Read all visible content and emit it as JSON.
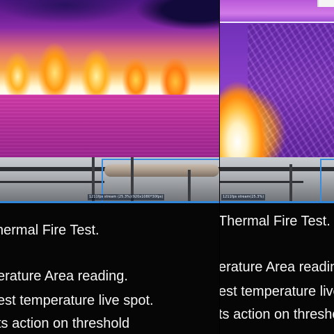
{
  "left_panel": {
    "stream_label": "1211fps stream (25.3%)(920x1080*30fps)",
    "caption_lines": [
      "hermal Fire Test.",
      "erature Area reading.",
      "est temperature live spot.",
      "ts action on threshold"
    ]
  },
  "right_panel": {
    "stream_label": "1211fps stream(25.3%)",
    "caption_lines": [
      "Thermal Fire Test.",
      "erature Area reading",
      "est temperature live",
      "ts action on thresho"
    ]
  }
}
